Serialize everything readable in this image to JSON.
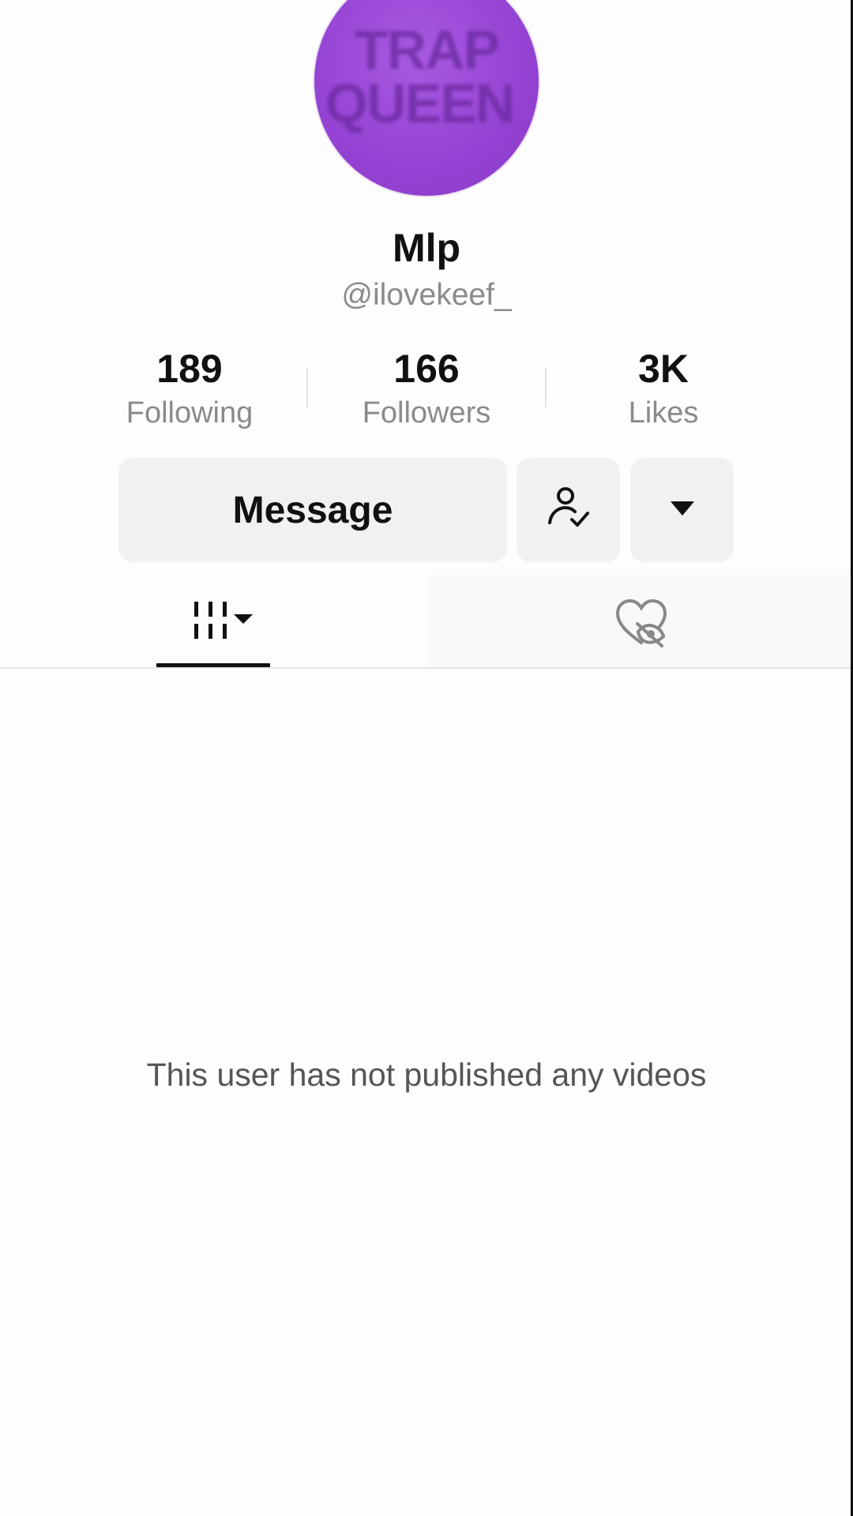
{
  "profile": {
    "avatar_text_line1": "TRAP",
    "avatar_text_line2": "QUEEN",
    "display_name": "Mlp",
    "username": "@ilovekeef_"
  },
  "stats": {
    "following": {
      "value": "189",
      "label": "Following"
    },
    "followers": {
      "value": "166",
      "label": "Followers"
    },
    "likes": {
      "value": "3K",
      "label": "Likes"
    }
  },
  "actions": {
    "message_label": "Message",
    "followed_icon": "user-check-icon",
    "more_icon": "caret-down-icon"
  },
  "tabs": [
    {
      "name": "videos",
      "icon": "video-grid-icon",
      "active": true
    },
    {
      "name": "liked",
      "icon": "heart-hidden-icon",
      "active": false
    }
  ],
  "content": {
    "empty_message": "This user has not published any videos"
  },
  "colors": {
    "avatar": "#9442d3",
    "text_primary": "#111111",
    "text_secondary": "#8a8a8a",
    "button_bg": "#f1f1f1"
  }
}
